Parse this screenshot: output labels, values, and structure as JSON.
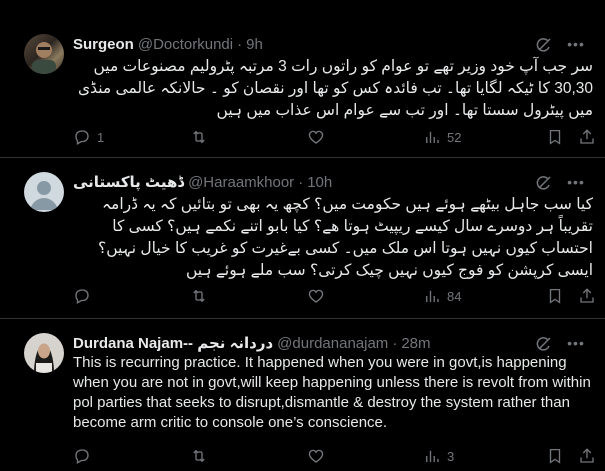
{
  "tweets": [
    {
      "name": "Surgeon",
      "handle": "@Doctorkundi",
      "sep": "·",
      "time": "9h",
      "text": "سر جب آپ خود وزیر تھے تو عوام کو راتوں رات 3 مرتبہ پٹرولیم مصنوعات میں 30,30 کا ٹیکہ لگایا تھا۔ تب فائدہ کس کو تھا اور نقصان کو ۔ حالانکہ عالمی منڈی میں پیٹرول سستا تھا۔ اور تب سے عوام اس عذاب میں ہیں",
      "reply_count": "1",
      "repost_count": "",
      "like_count": "",
      "view_count": "52"
    },
    {
      "name": "ڈھیٹ پاکستانی",
      "handle": "@Haraamkhoor",
      "sep": "·",
      "time": "10h",
      "text": "کیا سب جاہل بیٹھے ہوئے ہیں حکومت میں؟ کچھ یہ بھی تو بتائیں کہ یہ ڈرامہ تقریباً ہر دوسرے سال کیسے ریپیٹ ہوتا ھے؟ کیا بابو اتنے نکمے ہیں؟ کسی کا احتساب کیوں نہیں ہوتا اس ملک میں۔ کسی بےغیرت کو غریب کا خیال نہیں؟ ایسی کرپشن کو فوج کیوں نہیں چیک کرتی؟ سب ملے ہوئے ہیں",
      "reply_count": "",
      "repost_count": "",
      "like_count": "",
      "view_count": "84"
    },
    {
      "name": "Durdana Najam-- دردانہ نجم",
      "handle": "@durdananajam",
      "sep": "·",
      "time": "28m",
      "text": "This is recurring practice. It happened when you were in govt,is happening when you are not in govt,will keep happening unless there is revolt from within pol parties that seeks to disrupt,dismantle & destroy the system rather than become arm critic to console one’s conscience.",
      "reply_count": "",
      "repost_count": "",
      "like_count": "",
      "view_count": "3"
    }
  ],
  "icons": {
    "reply": "reply-icon",
    "repost": "repost-icon",
    "like": "like-icon",
    "views": "views-icon",
    "bookmark": "bookmark-icon",
    "share": "share-icon",
    "grok": "grok-icon",
    "more": "more-icon"
  },
  "colors": {
    "background": "#000000",
    "text": "#e7e9ea",
    "secondary": "#71767b",
    "divider": "#2f3336"
  }
}
